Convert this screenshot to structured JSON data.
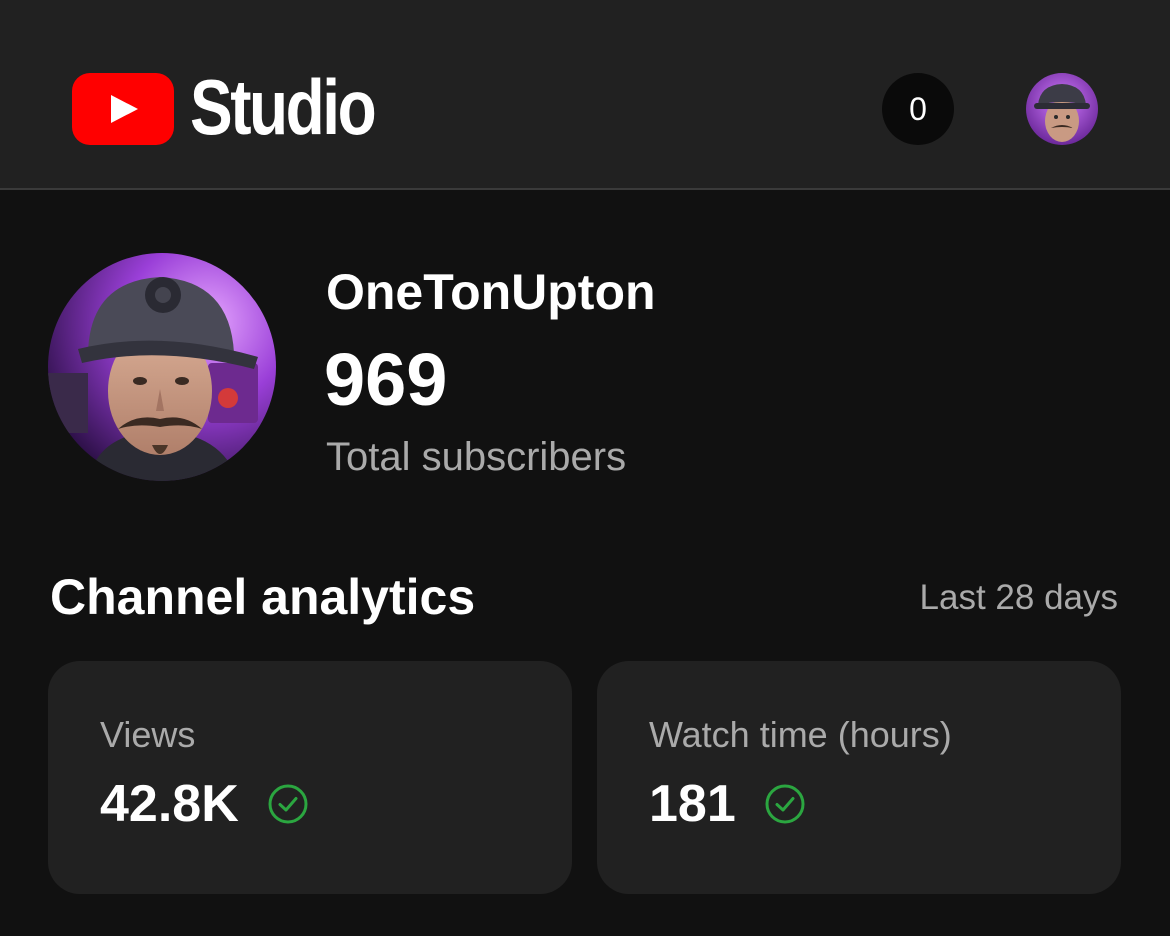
{
  "header": {
    "app_name": "Studio",
    "logo_icon": "youtube-play-icon",
    "notification_count": "0",
    "brand_color": "#ff0000"
  },
  "channel": {
    "name": "OneTonUpton",
    "subscribers": "969",
    "subscribers_label": "Total subscribers"
  },
  "analytics": {
    "title": "Channel analytics",
    "period": "Last 28 days",
    "cards": [
      {
        "label": "Views",
        "value": "42.8K",
        "status_icon": "check-circle-icon"
      },
      {
        "label": "Watch time (hours)",
        "value": "181",
        "status_icon": "check-circle-icon"
      }
    ],
    "status_color": "#2ba640"
  }
}
